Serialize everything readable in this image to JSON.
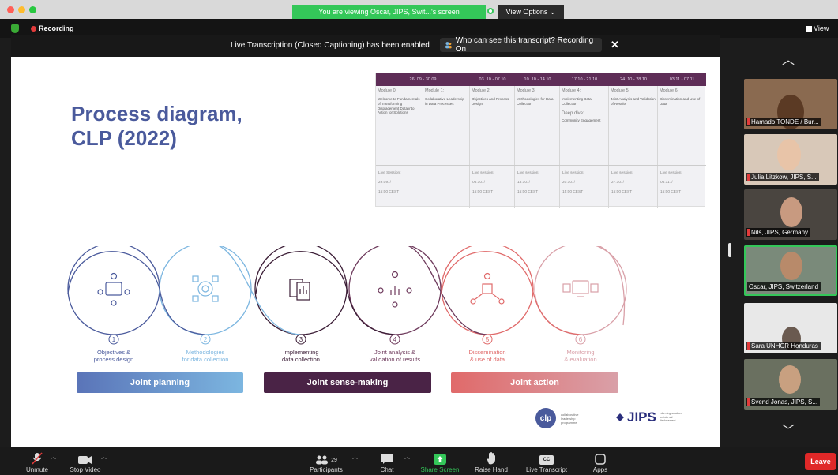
{
  "banner": {
    "viewing": "You are viewing Oscar, JIPS, Swit...'s screen",
    "view_options": "View Options ⌄"
  },
  "meeting": {
    "recording_label": "Recording",
    "view_label": "View"
  },
  "transcript": {
    "message": "Live Transcription (Closed Captioning) has been enabled",
    "who_can_see": "Who can see this transcript? Recording On",
    "close": "✕"
  },
  "slide": {
    "title": "Process diagram,\nCLP (2022)",
    "schedule": {
      "headers": [
        "26. 09 - 30.09",
        "03. 10 - 07.10",
        "10. 10 - 14.10",
        "17.10 - 21.10",
        "24. 10 - 28.10",
        "03.11 - 07.11"
      ],
      "modules": [
        {
          "name": "Module 0:",
          "desc": "Welcome to Fundamentals of Transforming Displacement Data into Action for Solutions"
        },
        {
          "name": "Module 1:",
          "desc": "Collaborative Leadership in Data Processes"
        },
        {
          "name": "Module 2:",
          "desc": "Objectives and Process Design"
        },
        {
          "name": "Module 3:",
          "desc": "Methodologies for Data Collection"
        },
        {
          "name": "Module 4:",
          "desc": "Implementing Data Collection",
          "deep_dive": "Deep dive:",
          "deep_desc": "Community Engagement"
        },
        {
          "name": "Module 5:",
          "desc": "Joint Analysis and Validation of Results"
        },
        {
          "name": "Module 6:",
          "desc": "Dissemination and Use of Data"
        }
      ],
      "sessions": [
        {
          "label": "Live Session:",
          "date": "29.09. /",
          "time": "15:00 CEST"
        },
        {
          "label": "Live session:",
          "date": "06.10. /",
          "time": "15:00 CEST"
        },
        {
          "label": "Live session:",
          "date": "13.10. /",
          "time": "15:00 CEST"
        },
        {
          "label": "Live session:",
          "date": "20.10. /",
          "time": "15:00 CEST"
        },
        {
          "label": "Live session:",
          "date": "27.10. /",
          "time": "15:00 CEST"
        },
        {
          "label": "Live session:",
          "date": "06.11. /",
          "time": "15:00 CEST"
        }
      ]
    },
    "steps": [
      {
        "num": "1",
        "line1": "Objectives &",
        "line2": "process design",
        "color": "#4a5a9c"
      },
      {
        "num": "2",
        "line1": "Methodologies",
        "line2": "for data collection",
        "color": "#7cb6e0"
      },
      {
        "num": "3",
        "line1": "Implementing",
        "line2": "data collection",
        "color": "#3b1d36"
      },
      {
        "num": "4",
        "line1": "Joint analysis &",
        "line2": "validation of results",
        "color": "#6e3a5c"
      },
      {
        "num": "5",
        "line1": "Dissemination",
        "line2": "& use of data",
        "color": "#e06a6a"
      },
      {
        "num": "6",
        "line1": "Monitoring",
        "line2": "& evaluation",
        "color": "#d9a0a8"
      }
    ],
    "phases": [
      {
        "label": "Joint planning",
        "color": "#5a74b8"
      },
      {
        "label": "Joint sense-making",
        "color": "#4a2346"
      },
      {
        "label": "Joint action",
        "color": "#d9707a"
      }
    ],
    "logos": {
      "clp": "clp",
      "clp_text": "collaborative leadership programme",
      "jips": "JIPS",
      "jips_text": "informing solutions for internal displacement"
    }
  },
  "participants": [
    {
      "name": "Hamado TONDE / Bur...",
      "muted": true,
      "active": false,
      "bg": "#8a6a50",
      "skin": "#5b3a24"
    },
    {
      "name": "Julia Litzkow, JIPS, S...",
      "muted": true,
      "active": false,
      "bg": "#d8c8b8",
      "skin": "#e8c4a8"
    },
    {
      "name": "Nils, JIPS, Germany",
      "muted": true,
      "active": false,
      "bg": "#4a4540",
      "skin": "#c89a80"
    },
    {
      "name": "Oscar, JIPS, Switzerland",
      "muted": false,
      "active": true,
      "bg": "#7a8a7a",
      "skin": "#b88a6a"
    },
    {
      "name": "Sara UNHCR Honduras",
      "muted": true,
      "active": false,
      "bg": "#e8e8e8",
      "skin": "#6a5a50"
    },
    {
      "name": "Svend Jonas, JIPS, S...",
      "muted": true,
      "active": false,
      "bg": "#6a7060",
      "skin": "#c8a080"
    }
  ],
  "toolbar": {
    "unmute": "Unmute",
    "stop_video": "Stop Video",
    "participants": "Participants",
    "participants_count": "29",
    "chat": "Chat",
    "share_screen": "Share Screen",
    "raise_hand": "Raise Hand",
    "live_transcript": "Live Transcript",
    "cc": "CC",
    "apps": "Apps",
    "leave": "Leave"
  },
  "colors": {
    "share_green": "#34c759",
    "leave_red": "#e02828",
    "title_blue": "#4a5a9c",
    "header_purple": "#5e2d57"
  }
}
